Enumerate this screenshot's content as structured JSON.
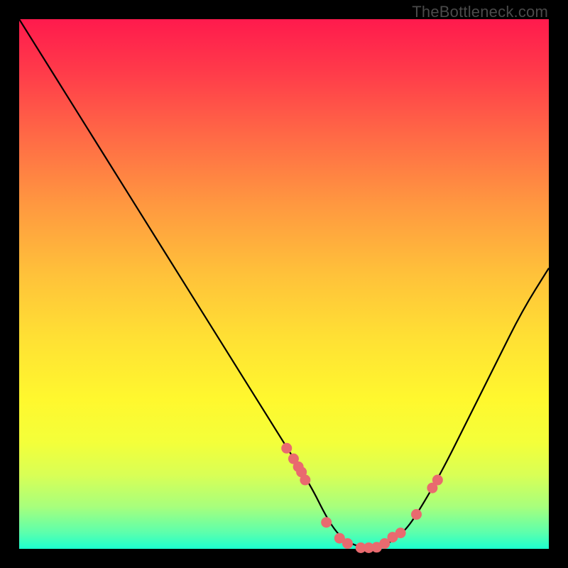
{
  "watermark": "TheBottleneck.com",
  "chart_data": {
    "type": "line",
    "title": "",
    "xlabel": "",
    "ylabel": "",
    "xlim": [
      0,
      100
    ],
    "ylim": [
      0,
      100
    ],
    "curve": {
      "x": [
        0,
        5,
        10,
        15,
        20,
        25,
        30,
        35,
        40,
        45,
        50,
        55,
        58,
        60,
        62,
        65,
        68,
        70,
        73,
        76,
        80,
        85,
        90,
        95,
        100
      ],
      "y": [
        100,
        92,
        84,
        76,
        68,
        60,
        52,
        44,
        36,
        28,
        20,
        12,
        6,
        3,
        1.2,
        0.2,
        0.2,
        1.2,
        3.5,
        8,
        15,
        25,
        35,
        45,
        53
      ]
    },
    "points": {
      "x": [
        50.5,
        51.8,
        52.7,
        53.3,
        54.0,
        58.0,
        60.5,
        62.0,
        64.5,
        66.0,
        67.5,
        69.0,
        70.5,
        72.0,
        75.0,
        78.0,
        79.0
      ],
      "y": [
        19.0,
        17.0,
        15.5,
        14.5,
        13.0,
        5.0,
        2.0,
        1.0,
        0.2,
        0.2,
        0.3,
        1.0,
        2.2,
        3.0,
        6.5,
        11.5,
        13.0
      ]
    },
    "colors": {
      "curve": "#000000",
      "points": "#e96a6f",
      "gradient_top": "#ff1a4d",
      "gradient_bottom": "#1cffcf"
    }
  }
}
